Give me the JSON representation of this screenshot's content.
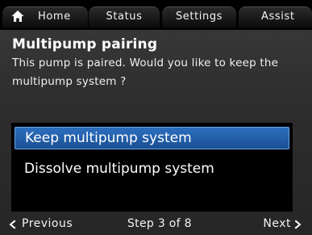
{
  "tabs": {
    "home": {
      "label": "Home",
      "icon": "home-icon"
    },
    "status": {
      "label": "Status"
    },
    "settings": {
      "label": "Settings"
    },
    "assist": {
      "label": "Assist"
    }
  },
  "header": {
    "title": "Multipump pairing",
    "description": "This pump is paired. Would you like to keep the multipump system ?"
  },
  "options": [
    {
      "label": "Keep multipump system",
      "selected": true
    },
    {
      "label": "Dissolve multipump system",
      "selected": false
    }
  ],
  "footer": {
    "previous_label": "Previous",
    "previous_icon": "chevron-left-icon",
    "step_label": "Step 3 of 8",
    "next_label": "Next",
    "next_icon": "chevron-right-icon"
  },
  "colors": {
    "selection": "#2a66b4",
    "background": "#2e2e2e",
    "list_background": "#000000"
  }
}
